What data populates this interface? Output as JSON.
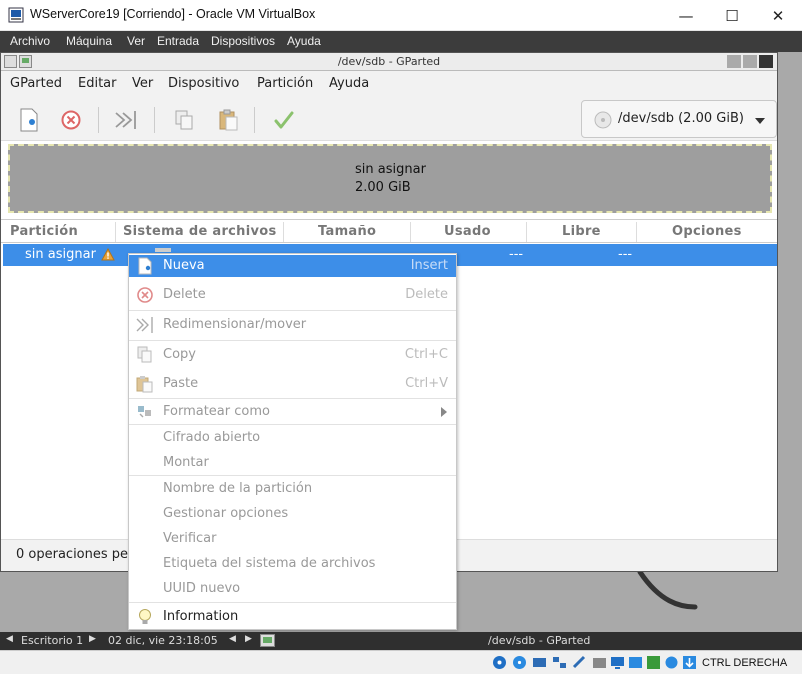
{
  "vbox": {
    "title": "WServerCore19 [Corriendo] - Oracle VM VirtualBox",
    "controls": {
      "minimize": "—",
      "maximize": "☐",
      "close": "✕"
    },
    "menu": [
      "Archivo",
      "Máquina",
      "Ver",
      "Entrada",
      "Dispositivos",
      "Ayuda"
    ],
    "status": {
      "host_key": "CTRL DERECHA"
    }
  },
  "gparted": {
    "window_title": "/dev/sdb - GParted",
    "menu": [
      "GParted",
      "Editar",
      "Ver",
      "Dispositivo",
      "Partición",
      "Ayuda"
    ],
    "device_selector": "/dev/sdb (2.00 GiB)",
    "map": {
      "label": "sin asignar",
      "size": "2.00 GiB"
    },
    "columns": [
      "Partición",
      "Sistema de archivos",
      "Tamaño",
      "Usado",
      "Libre",
      "Opciones"
    ],
    "row": {
      "partition": "sin asignar",
      "used": "---",
      "free": "---"
    },
    "status": "0 operaciones pe"
  },
  "context_menu": {
    "items": [
      {
        "label": "Nueva",
        "accel": "Insert"
      },
      {
        "label": "Delete",
        "accel": "Delete"
      },
      {
        "label": "Redimensionar/mover",
        "accel": ""
      },
      {
        "label": "Copy",
        "accel": "Ctrl+C"
      },
      {
        "label": "Paste",
        "accel": "Ctrl+V"
      },
      {
        "label": "Formatear como",
        "accel": ""
      },
      {
        "label": "Cifrado abierto",
        "accel": ""
      },
      {
        "label": "Montar",
        "accel": ""
      },
      {
        "label": "Nombre de la partición",
        "accel": ""
      },
      {
        "label": "Gestionar opciones",
        "accel": ""
      },
      {
        "label": "Verificar",
        "accel": ""
      },
      {
        "label": "Etiqueta del sistema de archivos",
        "accel": ""
      },
      {
        "label": "UUID nuevo",
        "accel": ""
      },
      {
        "label": "Information",
        "accel": ""
      }
    ]
  },
  "guest_bar": {
    "desktop": "Escritorio 1",
    "datetime": "02 dic, vie 23:18:05",
    "task": "/dev/sdb - GParted"
  },
  "colors": {
    "selection": "#3d8ee8",
    "vbox_menu": "#3c3c3c",
    "unallocated": "#9e9e9e"
  }
}
